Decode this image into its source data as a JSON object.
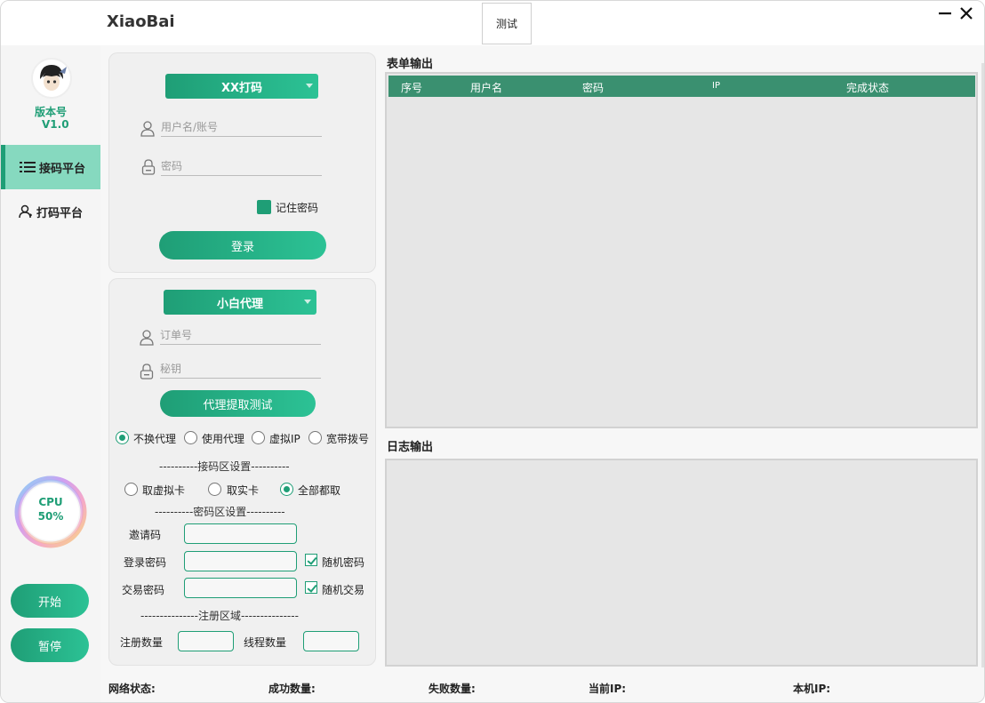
{
  "app": {
    "title": "XiaoBai",
    "test_button": "测试"
  },
  "sidebar": {
    "version_label": "版本号",
    "version_number": "V1.0",
    "nav": [
      {
        "label": "接码平台",
        "active": true
      },
      {
        "label": "打码平台",
        "active": false
      }
    ],
    "cpu_label": "CPU",
    "cpu_value": "50%",
    "start_label": "开始",
    "pause_label": "暂停"
  },
  "login_panel": {
    "dropdown": "XX打码",
    "username_placeholder": "用户名/账号",
    "password_placeholder": "密码",
    "remember_label": "记住密码",
    "login_button": "登录"
  },
  "proxy_panel": {
    "dropdown": "小白代理",
    "order_placeholder": "订单号",
    "key_placeholder": "秘钥",
    "test_button": "代理提取测试",
    "proxy_options": [
      "不换代理",
      "使用代理",
      "虚拟IP",
      "宽带拨号"
    ],
    "proxy_selected": 0,
    "code_section": "----------接码区设置----------",
    "code_options": [
      "取虚拟卡",
      "取实卡",
      "全部都取"
    ],
    "code_selected": 2,
    "password_section": "----------密码区设置----------",
    "invite_label": "邀请码",
    "login_pw_label": "登录密码",
    "random_pw_label": "随机密码",
    "trade_pw_label": "交易密码",
    "random_trade_label": "随机交易",
    "register_section": "---------------注册区域---------------",
    "register_count_label": "注册数量",
    "thread_count_label": "线程数量"
  },
  "form_output": {
    "title": "表单输出",
    "columns": [
      "序号",
      "用户名",
      "密码",
      "IP",
      "完成状态"
    ]
  },
  "log_output": {
    "title": "日志输出"
  },
  "statusbar": {
    "network": "网络状态:",
    "success": "成功数量:",
    "fail": "失败数量:",
    "current_ip": "当前IP:",
    "local_ip": "本机IP:"
  },
  "colors": {
    "accent": "#1f9e76",
    "accent_light": "#2cc295",
    "table_header": "#3a9070"
  }
}
